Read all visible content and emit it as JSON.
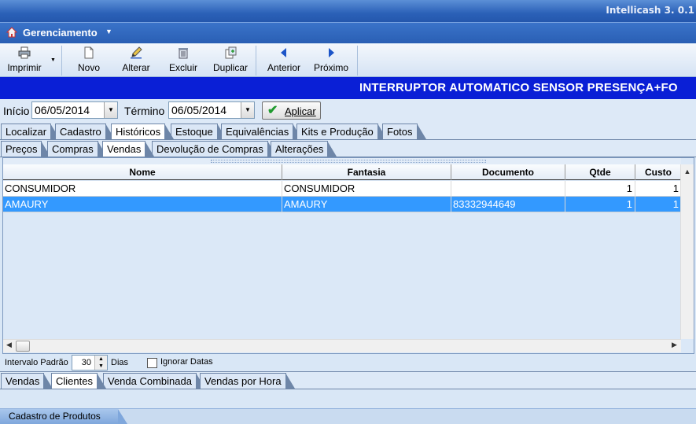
{
  "window": {
    "app_title": "Intellicash 3. 0.1"
  },
  "menubar": {
    "title": "Gerenciamento"
  },
  "toolbar": {
    "imprimir": "Imprimir",
    "novo": "Novo",
    "alterar": "Alterar",
    "excluir": "Excluir",
    "duplicar": "Duplicar",
    "anterior": "Anterior",
    "proximo": "Próximo"
  },
  "product_title": "INTERRUPTOR AUTOMATICO SENSOR PRESENÇA+FO",
  "filters": {
    "inicio_label": "Início",
    "inicio_value": "06/05/2014",
    "termino_label": "Término",
    "termino_value": "06/05/2014",
    "apply_label": "Aplicar"
  },
  "main_tabs": [
    "Localizar",
    "Cadastro",
    "Históricos",
    "Estoque",
    "Equivalências",
    "Kits e Produção",
    "Fotos"
  ],
  "history_tabs": [
    "Preços",
    "Compras",
    "Vendas",
    "Devolução de Compras",
    "Alterações"
  ],
  "table": {
    "columns": [
      "Nome",
      "Fantasia",
      "Documento",
      "Qtde",
      "Custo"
    ],
    "rows": [
      {
        "nome": "CONSUMIDOR",
        "fantasia": "CONSUMIDOR",
        "documento": "",
        "qtde": "1",
        "custo": "1"
      },
      {
        "nome": "AMAURY",
        "fantasia": "AMAURY",
        "documento": "83332944649",
        "qtde": "1",
        "custo": "1"
      }
    ]
  },
  "options": {
    "intervalo_label": "Intervalo Padrão",
    "intervalo_value": "30",
    "dias_label": "Dias",
    "ignorar_label": "Ignorar Datas"
  },
  "bottom_tabs": [
    "Vendas",
    "Clientes",
    "Venda Combinada",
    "Vendas por Hora"
  ],
  "status_tab": "Cadastro de Produtos"
}
